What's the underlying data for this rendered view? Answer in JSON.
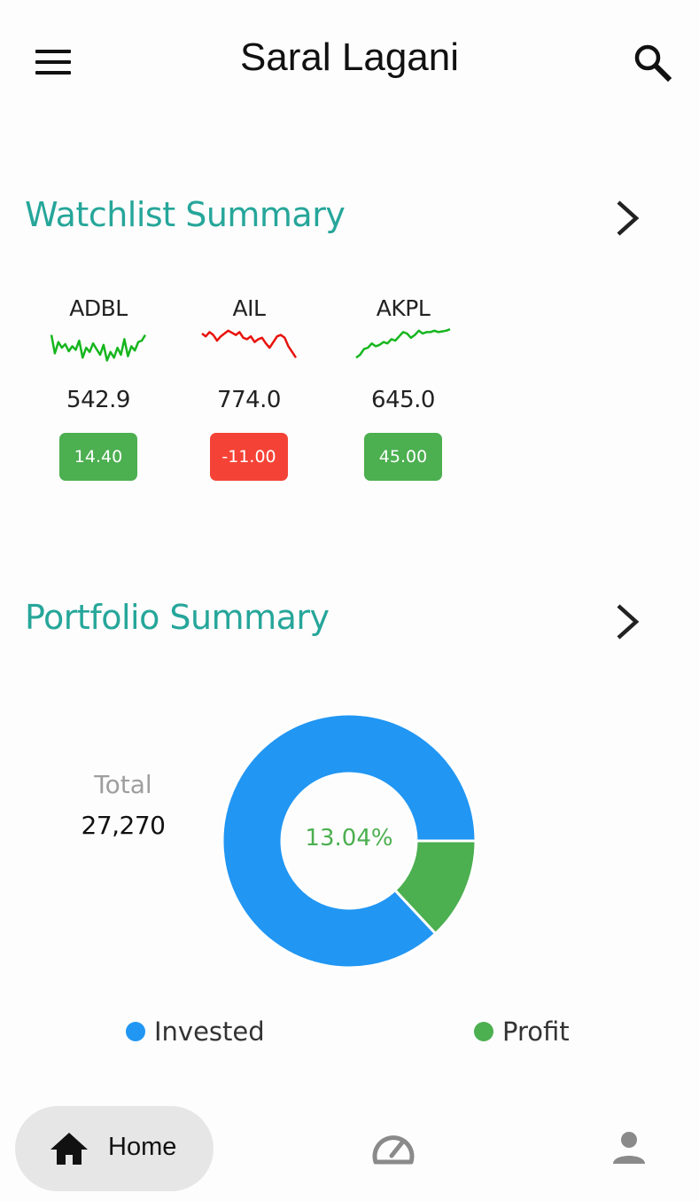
{
  "app": {
    "title": "Saral Lagani"
  },
  "watchlist": {
    "title": "Watchlist Summary",
    "stocks": [
      {
        "symbol": "ADBL",
        "price": "542.9",
        "change": "14.40",
        "trend": "up",
        "color": "#4caf50",
        "spark": [
          12,
          38,
          22,
          30,
          25,
          35,
          28,
          33,
          20,
          44,
          30,
          36,
          24,
          32,
          40,
          26,
          48,
          36,
          44,
          30,
          40,
          18,
          42,
          28,
          34,
          22,
          20,
          12
        ]
      },
      {
        "symbol": "AIL",
        "price": "774.0",
        "change": "-11.00",
        "trend": "down",
        "color": "#f44336",
        "spark": [
          10,
          14,
          8,
          12,
          20,
          14,
          10,
          6,
          9,
          12,
          8,
          16,
          18,
          14,
          22,
          18,
          16,
          24,
          30,
          22,
          14,
          12,
          16,
          28,
          36,
          44
        ]
      },
      {
        "symbol": "AKPL",
        "price": "645.0",
        "change": "45.00",
        "trend": "up",
        "color": "#4caf50",
        "spark": [
          44,
          40,
          32,
          30,
          24,
          28,
          26,
          22,
          24,
          18,
          20,
          14,
          8,
          10,
          16,
          12,
          6,
          10,
          8,
          8,
          6,
          8,
          7,
          6,
          4
        ]
      }
    ]
  },
  "portfolio": {
    "title": "Portfolio Summary",
    "total_label": "Total",
    "total_value": "27,270",
    "percent_label": "13.04%",
    "donut": [
      {
        "name": "Invested",
        "share": 0.8696,
        "color": "#2196f3"
      },
      {
        "name": "Profit",
        "share": 0.1304,
        "color": "#4caf50"
      }
    ],
    "legend": [
      {
        "label": "Invested",
        "color": "#2196f3"
      },
      {
        "label": "Profit",
        "color": "#4caf50"
      }
    ]
  },
  "nav": {
    "home_label": "Home",
    "items": [
      {
        "icon": "home-icon"
      },
      {
        "icon": "speedometer-icon"
      },
      {
        "icon": "person-icon"
      }
    ]
  },
  "colors": {
    "accent": "#26a69a",
    "positive": "#4caf50",
    "negative": "#f44336",
    "invested": "#2196f3"
  }
}
